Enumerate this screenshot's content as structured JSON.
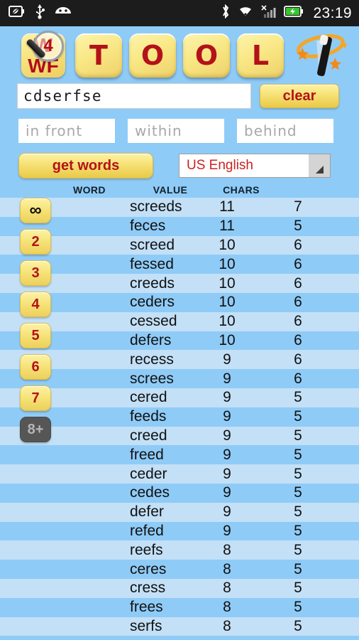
{
  "statusbar": {
    "time": "23:19",
    "left_icons": [
      "power-save-battery-icon",
      "usb-icon",
      "android-head-icon"
    ],
    "right_icons": [
      "bluetooth-icon",
      "wifi-icon",
      "signal-bars-icon",
      "battery-charging-icon"
    ]
  },
  "header": {
    "badge_line1": "W",
    "badge_line2": "WF",
    "badge_number": "4",
    "tiles": [
      "T",
      "O",
      "O",
      "L"
    ],
    "wand_icon": "magic-wand-icon"
  },
  "search": {
    "value": "cdserfse",
    "clear_label": "clear"
  },
  "position_inputs": [
    {
      "name": "in-front",
      "placeholder": "in front"
    },
    {
      "name": "within",
      "placeholder": "within"
    },
    {
      "name": "behind",
      "placeholder": "behind"
    }
  ],
  "actions": {
    "get_words_label": "get words",
    "language_value": "US English"
  },
  "filters": [
    {
      "label": "∞",
      "state": "on"
    },
    {
      "label": "2",
      "state": "on"
    },
    {
      "label": "3",
      "state": "on"
    },
    {
      "label": "4",
      "state": "on"
    },
    {
      "label": "5",
      "state": "on"
    },
    {
      "label": "6",
      "state": "on"
    },
    {
      "label": "7",
      "state": "on"
    },
    {
      "label": "8+",
      "state": "off"
    }
  ],
  "table": {
    "headers": {
      "word": "WORD",
      "value": "VALUE",
      "chars": "CHARS"
    },
    "rows": [
      {
        "word": "screeds",
        "value": "11",
        "chars": "7"
      },
      {
        "word": "feces",
        "value": "11",
        "chars": "5"
      },
      {
        "word": "screed",
        "value": "10",
        "chars": "6"
      },
      {
        "word": "fessed",
        "value": "10",
        "chars": "6"
      },
      {
        "word": "creeds",
        "value": "10",
        "chars": "6"
      },
      {
        "word": "ceders",
        "value": "10",
        "chars": "6"
      },
      {
        "word": "cessed",
        "value": "10",
        "chars": "6"
      },
      {
        "word": "defers",
        "value": "10",
        "chars": "6"
      },
      {
        "word": "recess",
        "value": "9",
        "chars": "6"
      },
      {
        "word": "screes",
        "value": "9",
        "chars": "6"
      },
      {
        "word": "cered",
        "value": "9",
        "chars": "5"
      },
      {
        "word": "feeds",
        "value": "9",
        "chars": "5"
      },
      {
        "word": "creed",
        "value": "9",
        "chars": "5"
      },
      {
        "word": "freed",
        "value": "9",
        "chars": "5"
      },
      {
        "word": "ceder",
        "value": "9",
        "chars": "5"
      },
      {
        "word": "cedes",
        "value": "9",
        "chars": "5"
      },
      {
        "word": "defer",
        "value": "9",
        "chars": "5"
      },
      {
        "word": "refed",
        "value": "9",
        "chars": "5"
      },
      {
        "word": "reefs",
        "value": "8",
        "chars": "5"
      },
      {
        "word": "ceres",
        "value": "8",
        "chars": "5"
      },
      {
        "word": "cress",
        "value": "8",
        "chars": "5"
      },
      {
        "word": "frees",
        "value": "8",
        "chars": "5"
      },
      {
        "word": "serfs",
        "value": "8",
        "chars": "5"
      }
    ]
  },
  "colors": {
    "page_bg": "#8fcbf7",
    "row_alt": "#c3e0f7",
    "accent_red": "#b3121a",
    "tile_yellow": "#f6e277",
    "statusbar_bg": "#1c1c1c"
  }
}
